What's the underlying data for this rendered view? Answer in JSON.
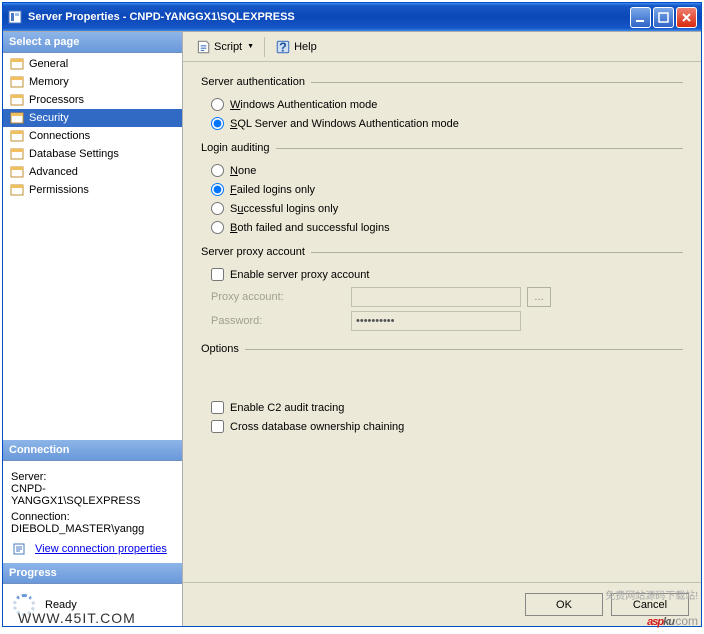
{
  "window": {
    "title": "Server Properties - CNPD-YANGGX1\\SQLEXPRESS"
  },
  "sidebar": {
    "selectPage": "Select a page",
    "items": [
      {
        "label": "General"
      },
      {
        "label": "Memory"
      },
      {
        "label": "Processors"
      },
      {
        "label": "Security"
      },
      {
        "label": "Connections"
      },
      {
        "label": "Database Settings"
      },
      {
        "label": "Advanced"
      },
      {
        "label": "Permissions"
      }
    ],
    "connection": {
      "header": "Connection",
      "serverLabel": "Server:",
      "serverValue": "CNPD-YANGGX1\\SQLEXPRESS",
      "connLabel": "Connection:",
      "connValue": "DIEBOLD_MASTER\\yangg",
      "viewLink": "View connection properties"
    },
    "progress": {
      "header": "Progress",
      "status": "Ready"
    }
  },
  "toolbar": {
    "script": "Script",
    "help": "Help"
  },
  "content": {
    "serverAuth": {
      "title": "Server authentication",
      "opt1": "Windows Authentication mode",
      "opt2": "SQL Server and Windows Authentication mode"
    },
    "loginAudit": {
      "title": "Login auditing",
      "none": "None",
      "failed": "Failed logins only",
      "success": "Successful logins only",
      "both": "Both failed and successful logins"
    },
    "proxy": {
      "title": "Server proxy account",
      "enable": "Enable server proxy account",
      "accountLabel": "Proxy account:",
      "passwordLabel": "Password:",
      "passwordValue": "**********",
      "browse": "..."
    },
    "options": {
      "title": "Options",
      "c2": "Enable C2 audit tracing",
      "crossdb": "Cross database ownership chaining"
    }
  },
  "footer": {
    "ok": "OK",
    "cancel": "Cancel"
  },
  "watermark": {
    "left": "WWW.45IT.COM",
    "asp": "asp",
    "ku": "ku",
    "com": ".com",
    "cn": "免费网站源码下载站!"
  }
}
